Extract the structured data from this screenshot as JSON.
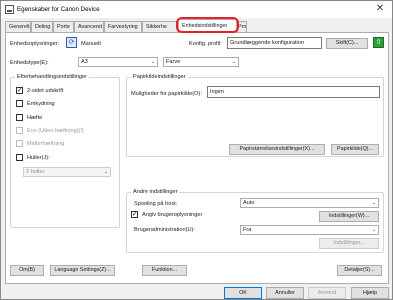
{
  "window": {
    "title": "Egenskaber for Canon Device",
    "close_glyph": "✕"
  },
  "tabs": [
    {
      "label": "Generelt"
    },
    {
      "label": "Deling"
    },
    {
      "label": "Porte"
    },
    {
      "label": "Avanceret"
    },
    {
      "label": "Farvestyring"
    },
    {
      "label": "Sikkerhe"
    },
    {
      "label": "Enhedsindstillinger"
    },
    {
      "label": "Profil"
    }
  ],
  "top": {
    "acquisition_label": "Enhedsoplysninger:",
    "acquisition_value": "Manuelt",
    "config_profile_label": "Konfig. profil:",
    "config_profile_value": "Grundlæggende konfiguration",
    "change_button": "Skift(C)...",
    "device_type_label": "Enhedstype(E):",
    "device_type_value": "A3",
    "color_value": "Farve"
  },
  "finishing": {
    "title": "Efterbehandlingsindstillinger",
    "options": [
      {
        "label": "2-sidet udskrift",
        "checked": true,
        "enabled": true
      },
      {
        "label": "Emkydning",
        "checked": false,
        "enabled": true
      },
      {
        "label": "Hæfte",
        "checked": false,
        "enabled": true
      },
      {
        "label": "Eco (Uden hæftning)(I)",
        "checked": false,
        "enabled": false
      },
      {
        "label": "Midterhæftning",
        "checked": false,
        "enabled": false
      },
      {
        "label": "Huller(J):",
        "checked": false,
        "enabled": true
      }
    ],
    "holes_value": "2 huller"
  },
  "paper_source": {
    "title": "Papirkildeindstillinger",
    "options_label": "Muligheder for papirkilde(O):",
    "options_value": "Ingen",
    "paper_size_button": "Papirstørrelsesindstillinger(X)...",
    "paper_source_button": "Papirkilde(Q)..."
  },
  "other": {
    "title": "Andre indstillinger",
    "spooling_label": "Spooling på host:",
    "spooling_value": "Auto",
    "user_settings_label": "Angiv brugeroplysninger",
    "user_settings_checked": true,
    "settings_button": "Indstillinger(W)...",
    "user_mgmt_label": "Brugeradministration(U):",
    "user_mgmt_value": "Fra",
    "settings_disabled_button": "Indstillinger..."
  },
  "bottom_buttons": {
    "about": "Om(B)",
    "language": "Language Settings(Z)...",
    "function": "Funktion...",
    "details": "Detaljer(S)..."
  },
  "dialog_buttons": {
    "ok": "OK",
    "cancel": "Annuller",
    "apply": "Anvend",
    "help": "Hjælp"
  },
  "colors": {
    "highlight": "#e8202a",
    "tab_border": "#adadad"
  }
}
